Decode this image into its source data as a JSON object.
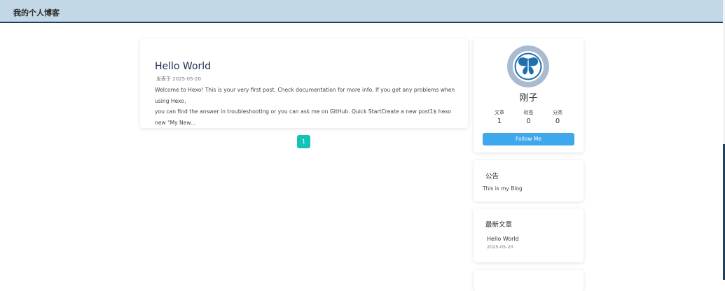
{
  "header": {
    "title": "我的个人博客"
  },
  "post": {
    "title": "Hello World",
    "meta": "发表于 2025-05-20",
    "excerpt_line1": "Welcome to Hexo! This is your very first post. Check documentation for more info. If you get any problems when using Hexo,",
    "excerpt_line2": "you can find the answer in troubleshooting or you can ask me on GitHub. Quick StartCreate a new post1$ hexo new \"My New..."
  },
  "pagination": {
    "current": "1"
  },
  "profile": {
    "name": "刚子",
    "avatar_icon": "butterfly-icon",
    "stats": [
      {
        "label": "文章",
        "value": "1"
      },
      {
        "label": "标签",
        "value": "0"
      },
      {
        "label": "分类",
        "value": "0"
      }
    ],
    "follow_label": "Follow Me"
  },
  "notice": {
    "heading": "公告",
    "text": "This is my Blog"
  },
  "recent": {
    "heading": "最新文章",
    "items": [
      {
        "title": "Hello World",
        "date": "2025-05-20"
      }
    ]
  },
  "colors": {
    "header_bg": "#c3d8e7",
    "header_border": "#1f3f5a",
    "accent_teal": "#13c4b6",
    "follow_blue": "#3fa7ec"
  }
}
